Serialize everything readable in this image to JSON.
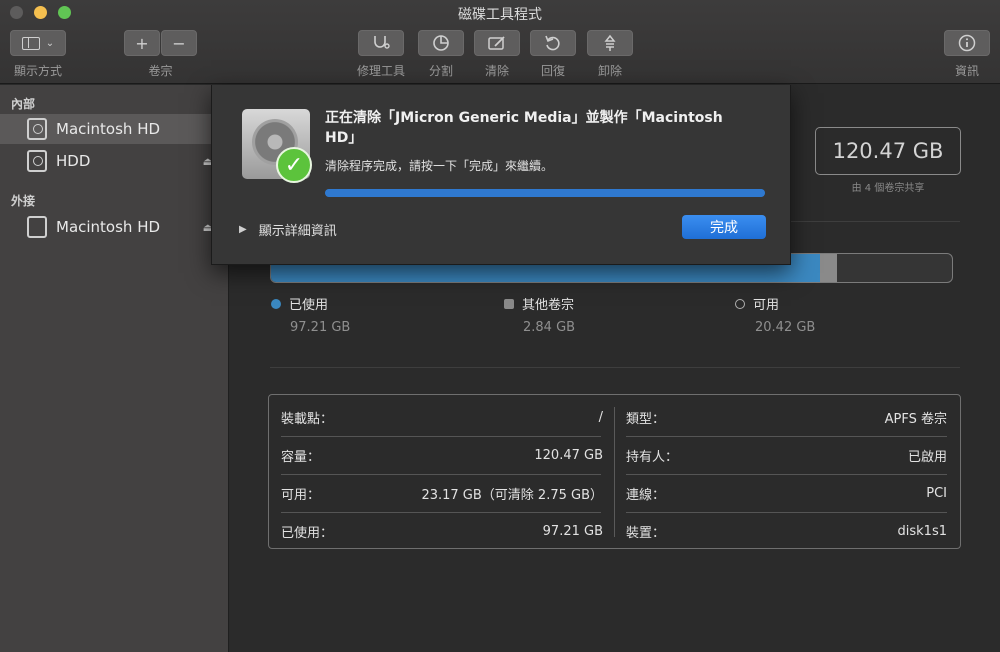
{
  "window": {
    "title": "磁碟工具程式"
  },
  "toolbar": {
    "view_label": "顯示方式",
    "volume_label": "卷宗",
    "volume_add": "+",
    "volume_remove": "−",
    "first_aid_label": "修理工具",
    "partition_label": "分割",
    "erase_label": "清除",
    "restore_label": "回復",
    "unmount_label": "卸除",
    "info_label": "資訊"
  },
  "sidebar": {
    "internal_header": "內部",
    "external_header": "外接",
    "items": [
      {
        "label": "Macintosh HD",
        "selected": true,
        "eject": false
      },
      {
        "label": "HDD",
        "selected": false,
        "eject": true
      },
      {
        "label": "Macintosh HD",
        "selected": false,
        "eject": true
      }
    ],
    "eject_symbol": "⏏"
  },
  "main": {
    "capacity": "120.47 GB",
    "shared_note": "由 4 個卷宗共享",
    "usage": {
      "used_fraction": 0.8069,
      "other_fraction": 0.0236,
      "used_color": "#3b88c0",
      "other_color": "#8a8a8a"
    },
    "legend": [
      {
        "label": "已使用",
        "value": "97.21 GB",
        "color": "#3b88c0"
      },
      {
        "label": "其他卷宗",
        "value": "2.84 GB",
        "color": "#8a8a8a"
      },
      {
        "label": "可用",
        "value": "20.42 GB",
        "color": "#2b2b2b"
      }
    ],
    "info_left": [
      {
        "key": "裝載點：",
        "value": "/"
      },
      {
        "key": "容量：",
        "value": "120.47 GB"
      },
      {
        "key": "可用：",
        "value": "23.17 GB（可清除 2.75 GB）"
      },
      {
        "key": "已使用：",
        "value": "97.21 GB"
      }
    ],
    "info_right": [
      {
        "key": "類型：",
        "value": "APFS 卷宗"
      },
      {
        "key": "持有人：",
        "value": "已啟用"
      },
      {
        "key": "連線：",
        "value": "PCI"
      },
      {
        "key": "裝置：",
        "value": "disk1s1"
      }
    ]
  },
  "dialog": {
    "title": "正在清除「JMicron Generic Media」並製作「Macintosh HD」",
    "message": "清除程序完成，請按一下「完成」來繼續。",
    "progress": 1.0,
    "details_label": "顯示詳細資訊",
    "done_label": "完成",
    "check_symbol": "✓"
  }
}
